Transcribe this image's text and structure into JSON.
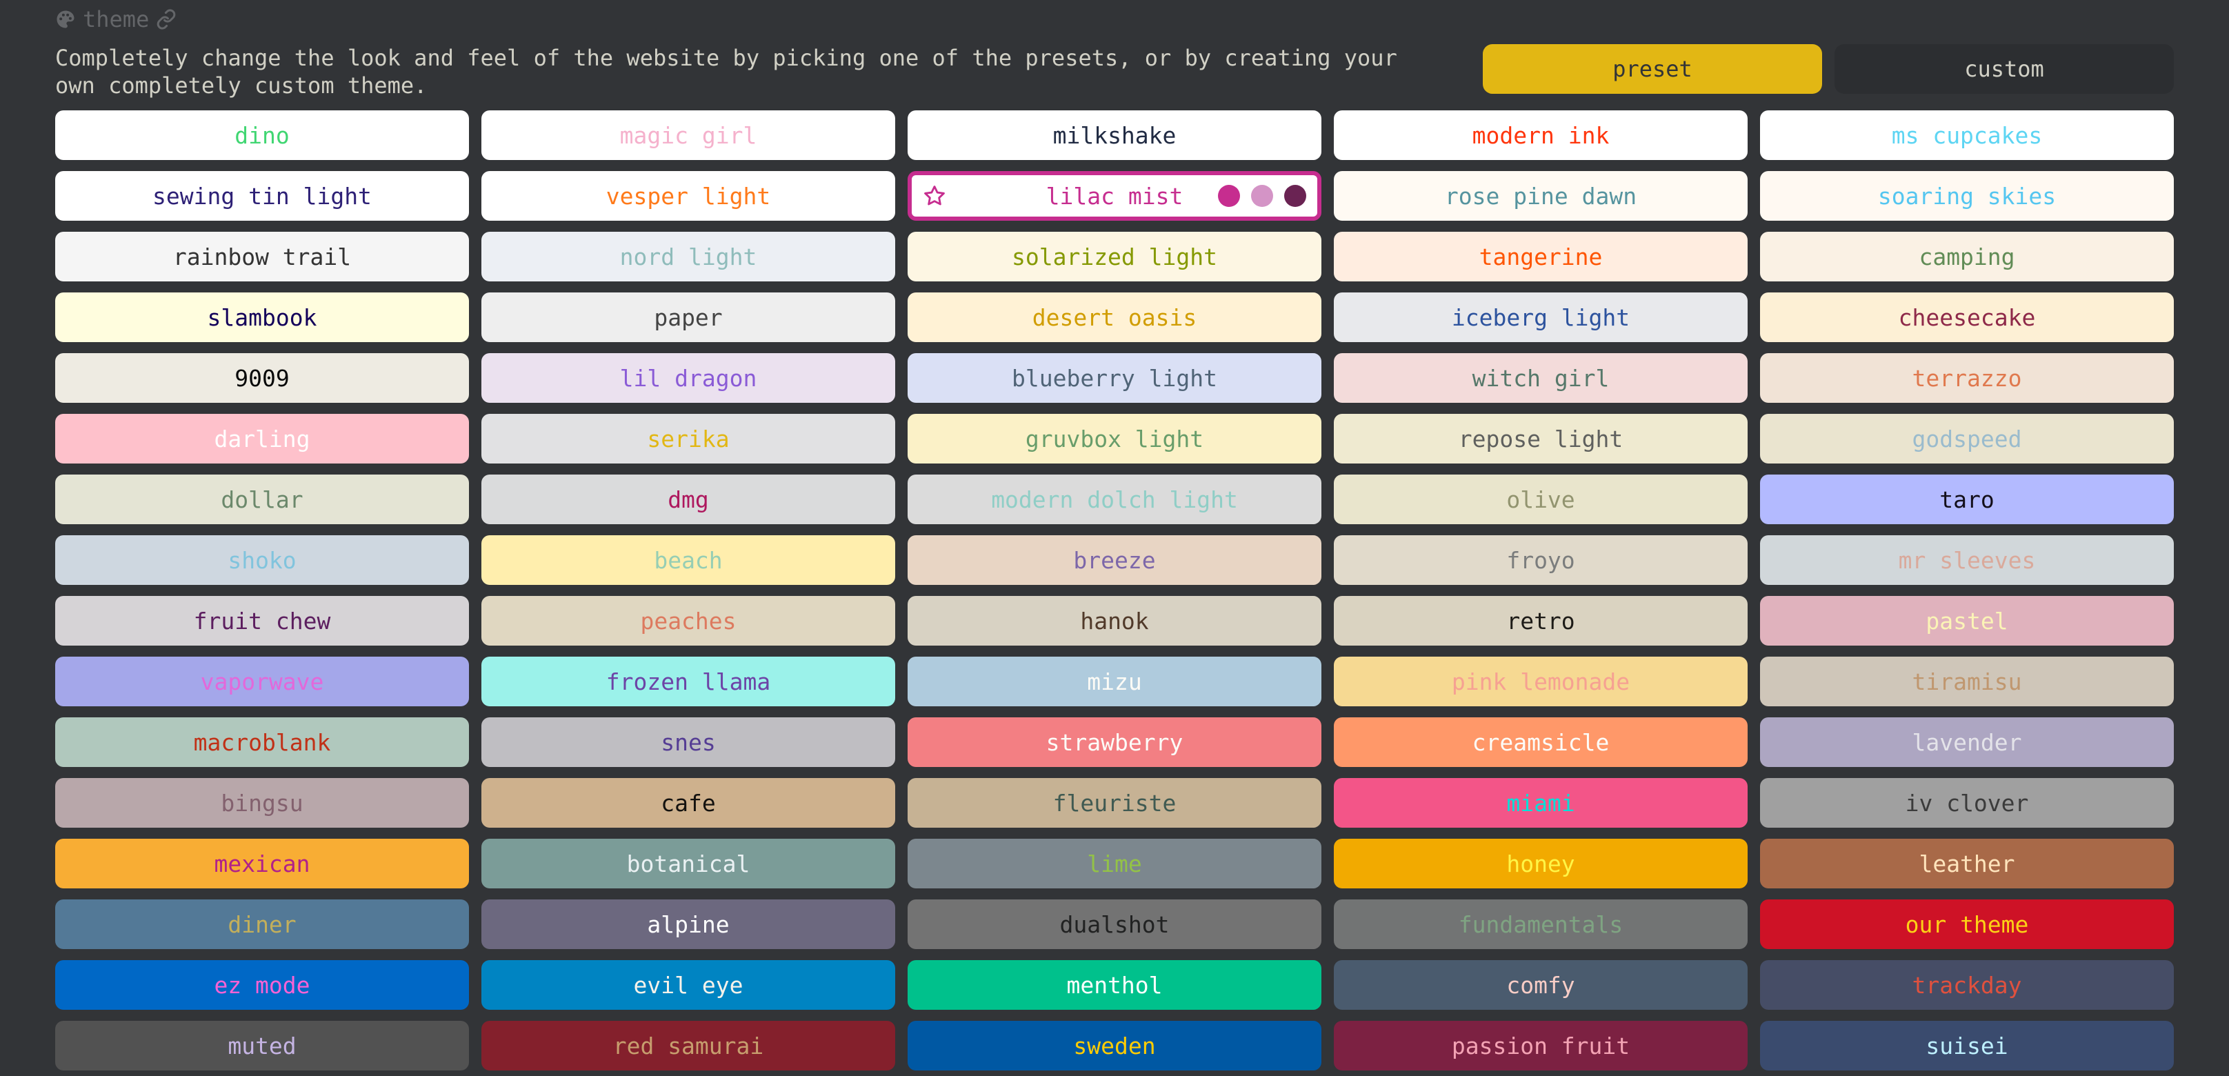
{
  "header": {
    "title": "theme",
    "description": "Completely change the look and feel of the website by picking one of the presets, or by creating your own completely custom theme."
  },
  "tabs": [
    {
      "label": "preset",
      "active": true
    },
    {
      "label": "custom",
      "active": false
    }
  ],
  "active_theme": "lilac mist",
  "active_theme_dots": [
    "#c62d8f",
    "#d494c6",
    "#6a2353"
  ],
  "themes": [
    {
      "name": "dino",
      "bg": "#ffffff",
      "fg": "#40d672"
    },
    {
      "name": "magic girl",
      "bg": "#ffffff",
      "fg": "#f5b1cc"
    },
    {
      "name": "milkshake",
      "bg": "#ffffff",
      "fg": "#212b43"
    },
    {
      "name": "modern ink",
      "bg": "#ffffff",
      "fg": "#ff360d"
    },
    {
      "name": "ms cupcakes",
      "bg": "#ffffff",
      "fg": "#5ed5f3"
    },
    {
      "name": "sewing tin light",
      "bg": "#ffffff",
      "fg": "#2d2076"
    },
    {
      "name": "vesper light",
      "bg": "#ffffff",
      "fg": "#ff7a1a"
    },
    {
      "name": "lilac mist",
      "bg": "#ffffff",
      "fg": "#c62d8f"
    },
    {
      "name": "rose pine dawn",
      "bg": "#fffaf3",
      "fg": "#56949f"
    },
    {
      "name": "soaring skies",
      "bg": "#fff9f2",
      "fg": "#55c6f0"
    },
    {
      "name": "rainbow trail",
      "bg": "#f5f5f5",
      "fg": "#333333"
    },
    {
      "name": "nord light",
      "bg": "#eceff4",
      "fg": "#8fbcbb"
    },
    {
      "name": "solarized light",
      "bg": "#fdf6e3",
      "fg": "#859900"
    },
    {
      "name": "tangerine",
      "bg": "#ffede0",
      "fg": "#fe5503"
    },
    {
      "name": "camping",
      "bg": "#faf1e4",
      "fg": "#618c56"
    },
    {
      "name": "slambook",
      "bg": "#fffdde",
      "fg": "#13005a"
    },
    {
      "name": "paper",
      "bg": "#eeeeee",
      "fg": "#444444"
    },
    {
      "name": "desert oasis",
      "bg": "#fff2d5",
      "fg": "#d19d01"
    },
    {
      "name": "iceberg light",
      "bg": "#e8e9ec",
      "fg": "#2d539e"
    },
    {
      "name": "cheesecake",
      "bg": "#fdf0d5",
      "fg": "#8e2949"
    },
    {
      "name": "9009",
      "bg": "#eeebe2",
      "fg": "#080909"
    },
    {
      "name": "lil dragon",
      "bg": "#ebe1ef",
      "fg": "#8a5bd6"
    },
    {
      "name": "blueberry light",
      "bg": "#dae0f5",
      "fg": "#506477"
    },
    {
      "name": "witch girl",
      "bg": "#f3dbda",
      "fg": "#56786a"
    },
    {
      "name": "terrazzo",
      "bg": "#f1e3d6",
      "fg": "#e0794e"
    },
    {
      "name": "darling",
      "bg": "#fec1cb",
      "fg": "#ffffff"
    },
    {
      "name": "serika",
      "bg": "#e1e1e3",
      "fg": "#e2b714"
    },
    {
      "name": "gruvbox light",
      "bg": "#fbf1c7",
      "fg": "#689d6a"
    },
    {
      "name": "repose light",
      "bg": "#efead0",
      "fg": "#5f605e"
    },
    {
      "name": "godspeed",
      "bg": "#eae4cf",
      "fg": "#9abbcd"
    },
    {
      "name": "dollar",
      "bg": "#e4e4d4",
      "fg": "#6b886b"
    },
    {
      "name": "dmg",
      "bg": "#dadbdc",
      "fg": "#ae185e"
    },
    {
      "name": "modern dolch light",
      "bg": "#dbdbdb",
      "fg": "#8fcec6"
    },
    {
      "name": "olive",
      "bg": "#e9e5cc",
      "fg": "#92946f"
    },
    {
      "name": "taro",
      "bg": "#b3baff",
      "fg": "#130f1a"
    },
    {
      "name": "shoko",
      "bg": "#ced7e0",
      "fg": "#81c4dd"
    },
    {
      "name": "beach",
      "bg": "#ffeead",
      "fg": "#96ceb4"
    },
    {
      "name": "breeze",
      "bg": "#e8d5c4",
      "fg": "#7d67a9"
    },
    {
      "name": "froyo",
      "bg": "#e1dacb",
      "fg": "#7b7d7d"
    },
    {
      "name": "mr sleeves",
      "bg": "#d1d7da",
      "fg": "#daa99b"
    },
    {
      "name": "fruit chew",
      "bg": "#d6d3d6",
      "fg": "#5c1e5f"
    },
    {
      "name": "peaches",
      "bg": "#e0d7c1",
      "fg": "#dd7a5f"
    },
    {
      "name": "hanok",
      "bg": "#d8d2c3",
      "fg": "#513a2a"
    },
    {
      "name": "retro",
      "bg": "#dad3c1",
      "fg": "#1d1b17"
    },
    {
      "name": "pastel",
      "bg": "#e0b2bd",
      "fg": "#fbf4b6"
    },
    {
      "name": "vaporwave",
      "bg": "#a4a7ea",
      "fg": "#e368da"
    },
    {
      "name": "frozen llama",
      "bg": "#9bf2ea",
      "fg": "#6d44a6"
    },
    {
      "name": "mizu",
      "bg": "#afcbdd",
      "fg": "#fcfbf6"
    },
    {
      "name": "pink lemonade",
      "bg": "#f6d992",
      "fg": "#f6a192"
    },
    {
      "name": "tiramisu",
      "bg": "#cfc6b9",
      "fg": "#c0976f"
    },
    {
      "name": "macroblank",
      "bg": "#b0c8bd",
      "fg": "#c13117"
    },
    {
      "name": "snes",
      "bg": "#bfbec2",
      "fg": "#553d94"
    },
    {
      "name": "strawberry",
      "bg": "#f37f83",
      "fg": "#fcfcf8"
    },
    {
      "name": "creamsicle",
      "bg": "#ff9869",
      "fg": "#fcfcf8"
    },
    {
      "name": "lavender",
      "bg": "#ada6c2",
      "fg": "#e4e3e9"
    },
    {
      "name": "bingsu",
      "bg": "#b8a7aa",
      "fg": "#83616e"
    },
    {
      "name": "cafe",
      "bg": "#ceb18d",
      "fg": "#14120f"
    },
    {
      "name": "fleuriste",
      "bg": "#c6b294",
      "fg": "#405a52"
    },
    {
      "name": "miami",
      "bg": "#f35588",
      "fg": "#05dfd7"
    },
    {
      "name": "iv clover",
      "bg": "#a0a0a0",
      "fg": "#3b3b3b"
    },
    {
      "name": "mexican",
      "bg": "#f8ad34",
      "fg": "#b12189"
    },
    {
      "name": "botanical",
      "bg": "#7b9c98",
      "fg": "#eaf1f3"
    },
    {
      "name": "lime",
      "bg": "#7c878e",
      "fg": "#93c247"
    },
    {
      "name": "honey",
      "bg": "#f2aa00",
      "fg": "#fff546"
    },
    {
      "name": "leather",
      "bg": "#a86948",
      "fg": "#ffe4bc"
    },
    {
      "name": "diner",
      "bg": "#537997",
      "fg": "#c3af5b"
    },
    {
      "name": "alpine",
      "bg": "#6c687f",
      "fg": "#ffffff"
    },
    {
      "name": "dualshot",
      "bg": "#737373",
      "fg": "#212222"
    },
    {
      "name": "fundamentals",
      "bg": "#727474",
      "fg": "#7fa482"
    },
    {
      "name": "our theme",
      "bg": "#ce1226",
      "fg": "#fcd116"
    },
    {
      "name": "ez mode",
      "bg": "#0068c6",
      "fg": "#fa62d5"
    },
    {
      "name": "evil eye",
      "bg": "#0084c2",
      "fg": "#f7f2ea"
    },
    {
      "name": "menthol",
      "bg": "#00c18c",
      "fg": "#ffffff"
    },
    {
      "name": "comfy",
      "bg": "#4a5b6e",
      "fg": "#f8cdc6"
    },
    {
      "name": "trackday",
      "bg": "#464d66",
      "fg": "#e0513e"
    },
    {
      "name": "muted",
      "bg": "#525252",
      "fg": "#c5b4e3"
    },
    {
      "name": "red samurai",
      "bg": "#84202c",
      "fg": "#c79e6e"
    },
    {
      "name": "sweden",
      "bg": "#0058a3",
      "fg": "#ffcc02"
    },
    {
      "name": "passion fruit",
      "bg": "#7c2142",
      "fg": "#f4a3b4"
    },
    {
      "name": "suisei",
      "bg": "#3a4b6e",
      "fg": "#bef0ff"
    }
  ]
}
